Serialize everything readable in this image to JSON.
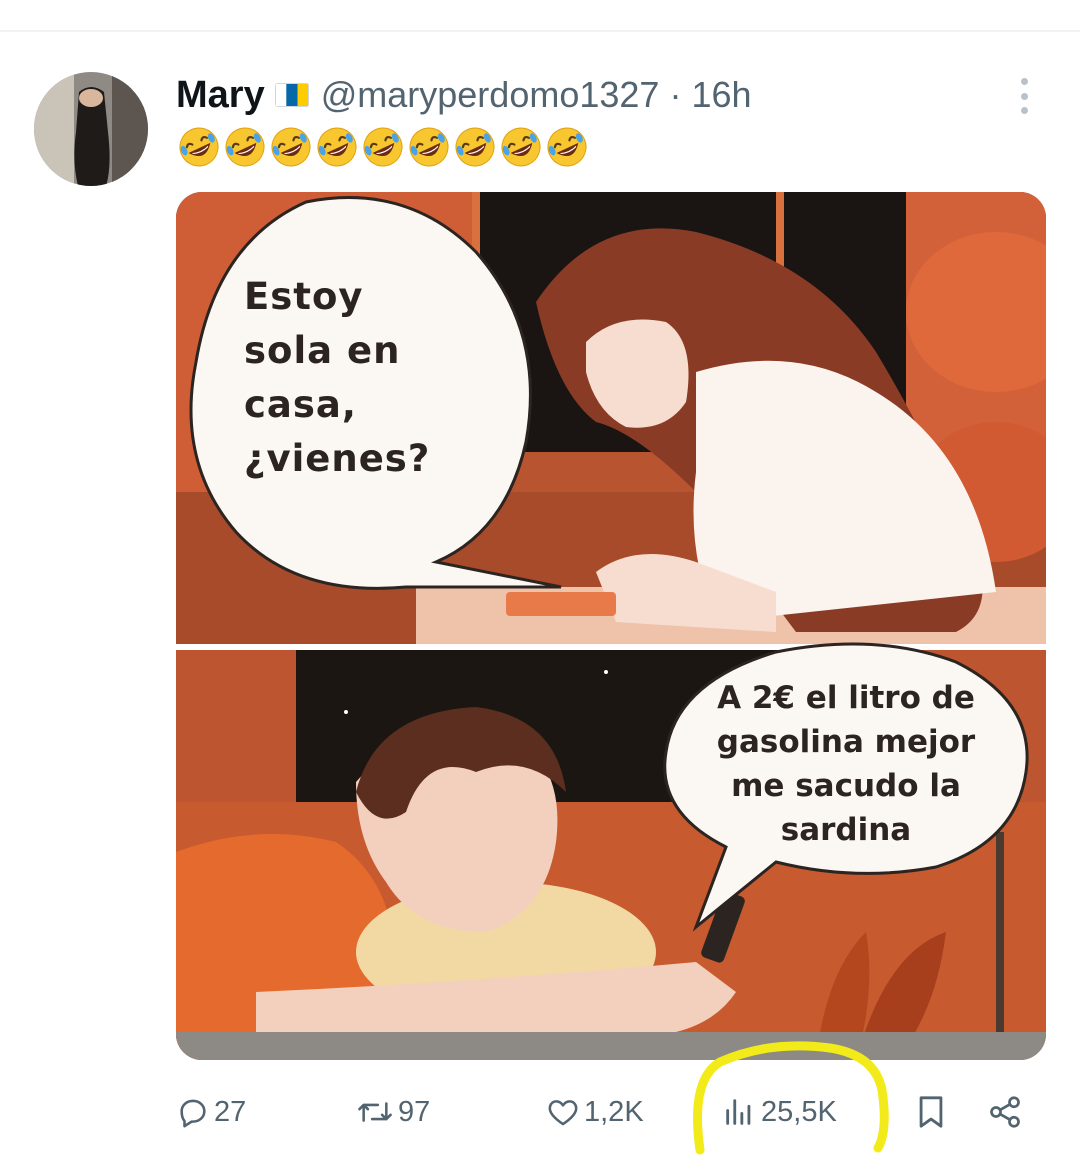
{
  "tweet": {
    "author_name": "Mary",
    "handle": "@maryperdomo1327",
    "separator": "·",
    "time": "16h",
    "text_emoji_count": 9,
    "text_emoji": "rolling-on-floor-laughing"
  },
  "media": {
    "bubble_top_lines": [
      "Estoy",
      "sola en",
      "casa,",
      "¿vienes?"
    ],
    "bubble_bottom_lines": [
      "A 2€ el litro de",
      "gasolina mejor",
      "me sacudo la",
      "sardina"
    ]
  },
  "actions": {
    "replies": "27",
    "retweets": "97",
    "likes": "1,2K",
    "views": "25,5K"
  },
  "colors": {
    "text_primary": "#0f1419",
    "text_secondary": "#536471",
    "highlight": "#f3ea1a",
    "panel_red": "#c35a35"
  },
  "icons": [
    "avatar",
    "canary-islands-flag-icon",
    "more-icon",
    "reply-icon",
    "retweet-icon",
    "like-icon",
    "views-icon",
    "bookmark-icon",
    "share-icon"
  ]
}
